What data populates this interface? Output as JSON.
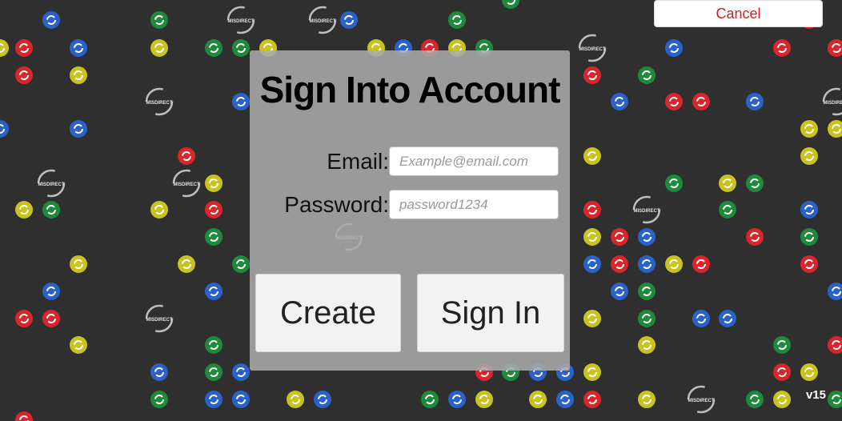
{
  "dialog": {
    "title": "Sign Into Account",
    "email_label": "Email:",
    "email_placeholder": "Example@email.com",
    "email_value": "",
    "password_label": "Password:",
    "password_placeholder": "password1234",
    "password_value": "",
    "create_label": "Create",
    "signin_label": "Sign In"
  },
  "header": {
    "cancel_label": "Cancel"
  },
  "footer": {
    "version": "v15"
  },
  "board": {
    "misdirect_text": "MISDIRECT",
    "colors": {
      "background": "#2f2f2f",
      "red": "#d9262c",
      "green": "#1f8a3c",
      "blue": "#2a62c9",
      "yellow": "#c9c21f",
      "cancel_text": "#d21f1f"
    }
  }
}
